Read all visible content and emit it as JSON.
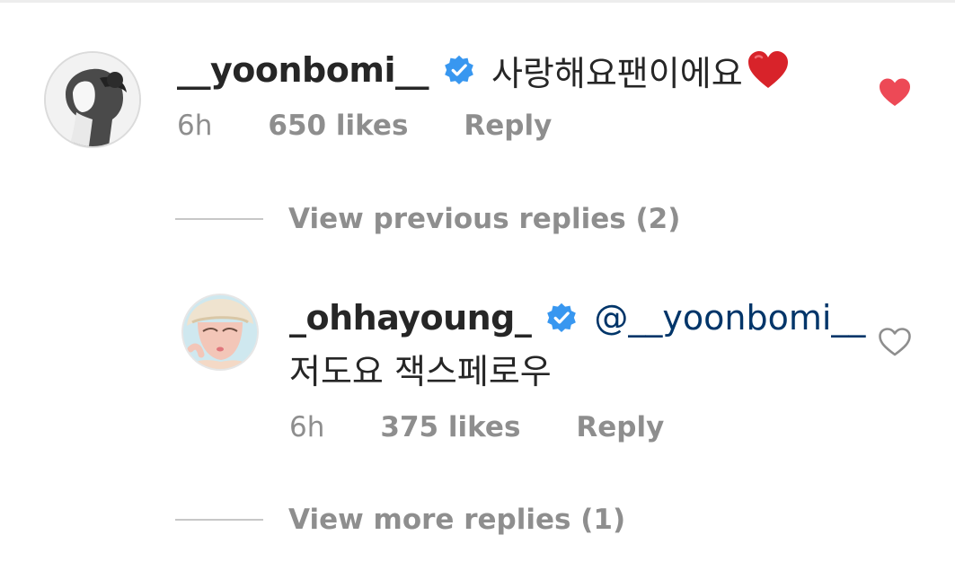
{
  "comments": [
    {
      "username": "__yoonbomi__",
      "verified": true,
      "text": "사랑해요팬이에요",
      "emoji": "red-heart",
      "time": "6h",
      "likes": "650 likes",
      "reply_label": "Reply",
      "liked": true
    }
  ],
  "replies_previous_label": "View previous replies (2)",
  "reply": {
    "username": "_ohhayoung_",
    "verified": true,
    "mention": "@__yoonbomi__",
    "text": "저도요 잭스페로우",
    "time": "6h",
    "likes": "375 likes",
    "reply_label": "Reply",
    "liked": false
  },
  "replies_more_label": "View more replies (1)",
  "colors": {
    "heart_active": "#ed4956",
    "verified_blue": "#3897f0",
    "mention": "#003569",
    "meta_gray": "#8e8e8e"
  }
}
